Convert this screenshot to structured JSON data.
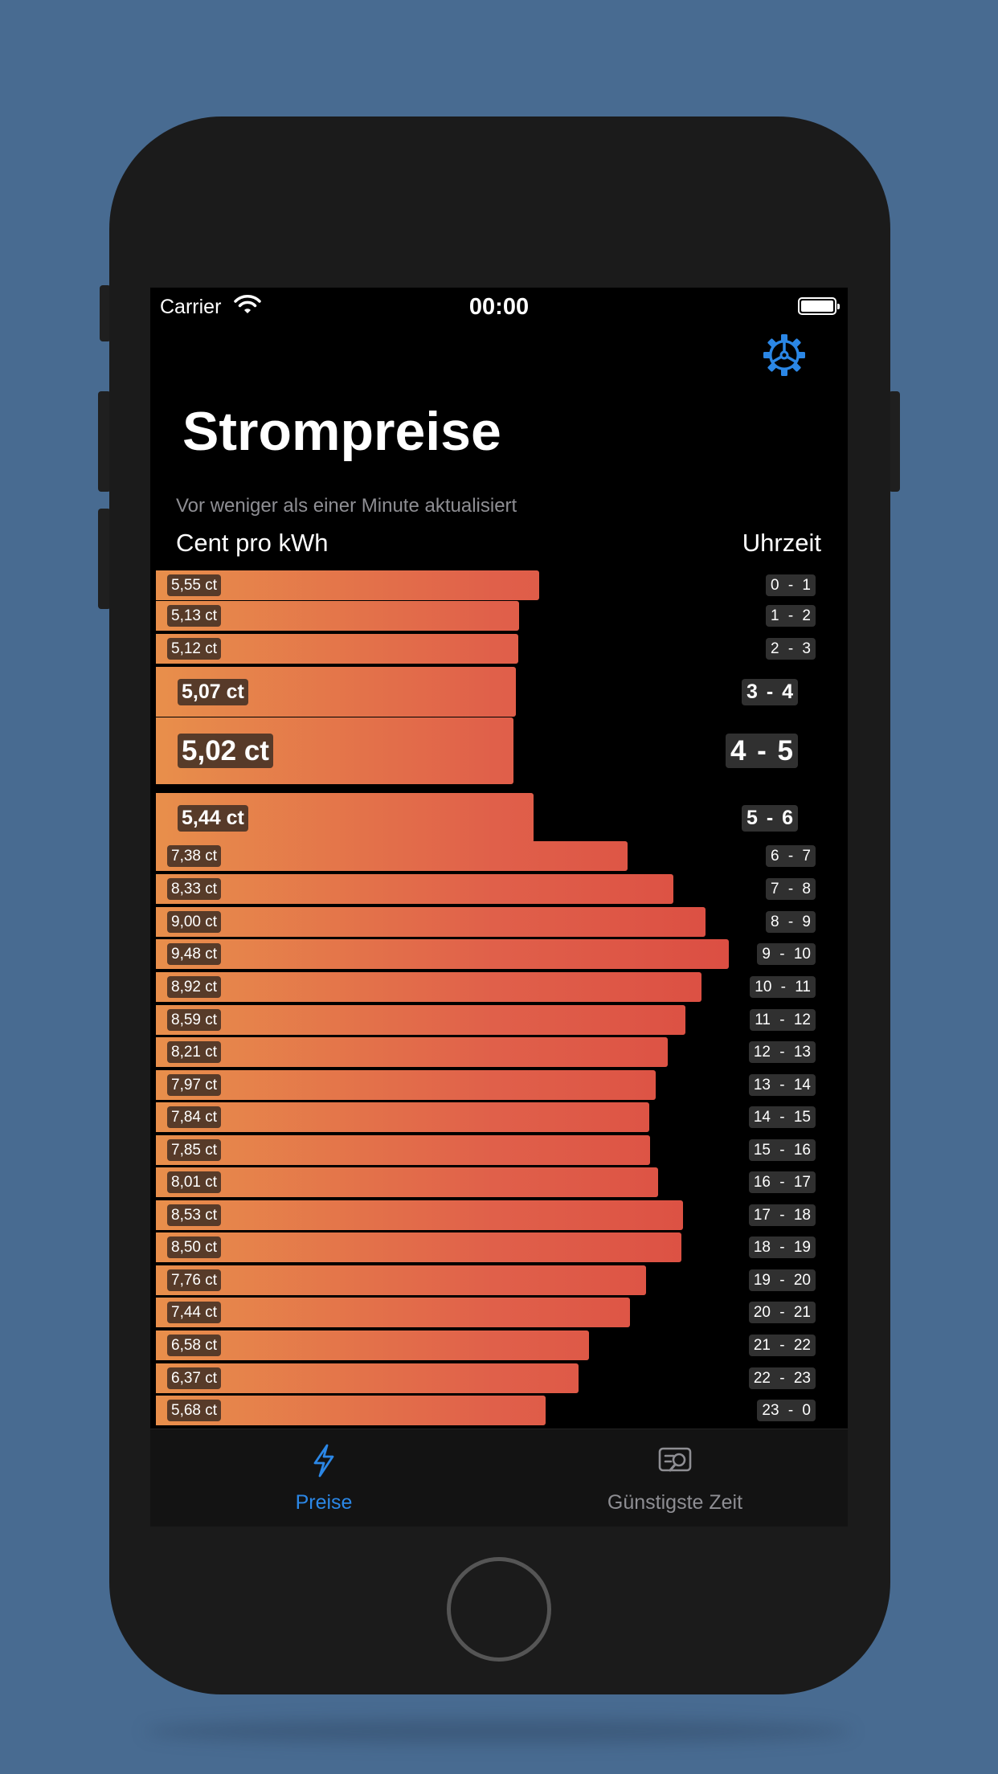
{
  "status_bar": {
    "carrier": "Carrier",
    "time": "00:00"
  },
  "header": {
    "title": "Strompreise",
    "updated": "Vor weniger als einer Minute aktualisiert",
    "col_price": "Cent pro kWh",
    "col_time": "Uhrzeit"
  },
  "prices": [
    {
      "price": "5,55 ct",
      "hours": "0 - 1",
      "value": 5.55
    },
    {
      "price": "5,13 ct",
      "hours": "1 - 2",
      "value": 5.13
    },
    {
      "price": "5,12 ct",
      "hours": "2 - 3",
      "value": 5.12
    },
    {
      "price": "5,07 ct",
      "hours": "3 - 4",
      "value": 5.07
    },
    {
      "price": "5,02 ct",
      "hours": "4 - 5",
      "value": 5.02
    },
    {
      "price": "5,44 ct",
      "hours": "5 - 6",
      "value": 5.44
    },
    {
      "price": "7,38 ct",
      "hours": "6 - 7",
      "value": 7.38
    },
    {
      "price": "8,33 ct",
      "hours": "7 - 8",
      "value": 8.33
    },
    {
      "price": "9,00 ct",
      "hours": "8 - 9",
      "value": 9.0
    },
    {
      "price": "9,48 ct",
      "hours": "9 - 10",
      "value": 9.48
    },
    {
      "price": "8,92 ct",
      "hours": "10 - 11",
      "value": 8.92
    },
    {
      "price": "8,59 ct",
      "hours": "11 - 12",
      "value": 8.59
    },
    {
      "price": "8,21 ct",
      "hours": "12 - 13",
      "value": 8.21
    },
    {
      "price": "7,97 ct",
      "hours": "13 - 14",
      "value": 7.97
    },
    {
      "price": "7,84 ct",
      "hours": "14 - 15",
      "value": 7.84
    },
    {
      "price": "7,85 ct",
      "hours": "15 - 16",
      "value": 7.85
    },
    {
      "price": "8,01 ct",
      "hours": "16 - 17",
      "value": 8.01
    },
    {
      "price": "8,53 ct",
      "hours": "17 - 18",
      "value": 8.53
    },
    {
      "price": "8,50 ct",
      "hours": "18 - 19",
      "value": 8.5
    },
    {
      "price": "7,76 ct",
      "hours": "19 - 20",
      "value": 7.76
    },
    {
      "price": "7,44 ct",
      "hours": "20 - 21",
      "value": 7.44
    },
    {
      "price": "6,58 ct",
      "hours": "21 - 22",
      "value": 6.58
    },
    {
      "price": "6,37 ct",
      "hours": "22 - 23",
      "value": 6.37
    },
    {
      "price": "5,68 ct",
      "hours": "23 - 0",
      "value": 5.68
    }
  ],
  "tabs": [
    {
      "label": "Preise",
      "icon": "bolt-icon",
      "selected": true
    },
    {
      "label": "Günstigste Zeit",
      "icon": "search-text-icon",
      "selected": false
    }
  ],
  "colors": {
    "accent": "#2b87e6",
    "bar_start": "#e88f4b",
    "bar_end": "#da4840",
    "page_bg": "#486b91"
  }
}
